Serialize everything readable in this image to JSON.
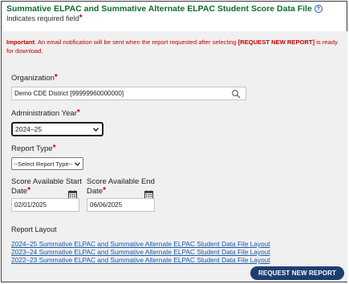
{
  "header": {
    "title": "Summative ELPAC and Summative Alternate ELPAC Student Score Data File",
    "required_note": "Indicates required field",
    "required_mark": "*"
  },
  "notice": {
    "label": "Important",
    "text_before": ": An email notification will be sent when the report requested after selecting ",
    "action": "[REQUEST NEW REPORT]",
    "text_after": " is ready for download."
  },
  "form": {
    "organization": {
      "label": "Organization",
      "value": "Demo CDE District [99999960000000]"
    },
    "admin_year": {
      "label": "Administration Year",
      "value": "2024–25"
    },
    "report_type": {
      "label": "Report Type",
      "value": "--Select Report Type--"
    },
    "start_date": {
      "label_line1": "Score Available Start",
      "label_line2": "Date",
      "value": "02/01/2025"
    },
    "end_date": {
      "label_line1": "Score Available End",
      "label_line2": "Date",
      "value": "06/06/2025"
    }
  },
  "layout_section": {
    "label": "Report Layout",
    "links": [
      "2024–25 Summative ELPAC and Summative Alternate ELPAC Student Data File Layout",
      "2023–24 Summative ELPAC and Summative Alternate ELPAC Student Data File Layout",
      "2022–23 Summative ELPAC and Summative Alternate ELPAC Student Data File Layout"
    ]
  },
  "actions": {
    "request_label": "REQUEST NEW REPORT"
  },
  "colors": {
    "title": "#0f6b2f",
    "required": "#c00000",
    "link": "#1a5aa8",
    "button": "#1c3f73"
  },
  "icons": [
    "help-icon",
    "search-icon",
    "chevron-down-icon",
    "calendar-icon"
  ]
}
